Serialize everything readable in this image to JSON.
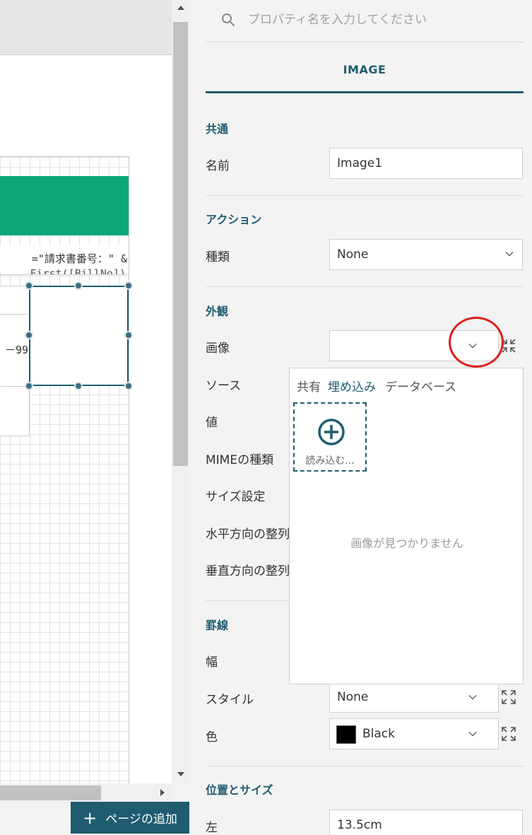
{
  "canvas": {
    "invoice_expression_line1": "=\"請求書番号：\" &",
    "invoice_expression_line2": "First([BillNo])",
    "number_text": "－99"
  },
  "add_page_button": {
    "label": "ページの追加"
  },
  "search": {
    "placeholder": "プロパティ名を入力してください"
  },
  "tab": {
    "label": "IMAGE"
  },
  "sections": {
    "common": {
      "title": "共通",
      "name_label": "名前",
      "name_value": "Image1"
    },
    "action": {
      "title": "アクション",
      "type_label": "種類",
      "type_value": "None"
    },
    "appearance": {
      "title": "外観",
      "image_label": "画像",
      "image_value": "",
      "source_label": "ソース",
      "value_label": "値",
      "mime_label": "MIMEの種類",
      "sizing_label": "サイズ設定",
      "halign_label": "水平方向の整列",
      "valign_label": "垂直方向の整列"
    },
    "border": {
      "title": "罫線",
      "width_label": "幅",
      "style_label": "スタイル",
      "style_value": "None",
      "color_label": "色",
      "color_value": "Black",
      "color_swatch": "#000000"
    },
    "position_size": {
      "title": "位置とサイズ",
      "left_label": "左",
      "left_value": "13.5cm"
    }
  },
  "image_popup": {
    "tabs": [
      "共有",
      "埋め込み",
      "データベース"
    ],
    "active_tab": "埋め込み",
    "upload_label": "読み込む...",
    "empty_message": "画像が見つかりません"
  },
  "colors": {
    "accent": "#1f5c70",
    "band_green": "#0aa779",
    "highlight_red": "#e01c1c"
  }
}
